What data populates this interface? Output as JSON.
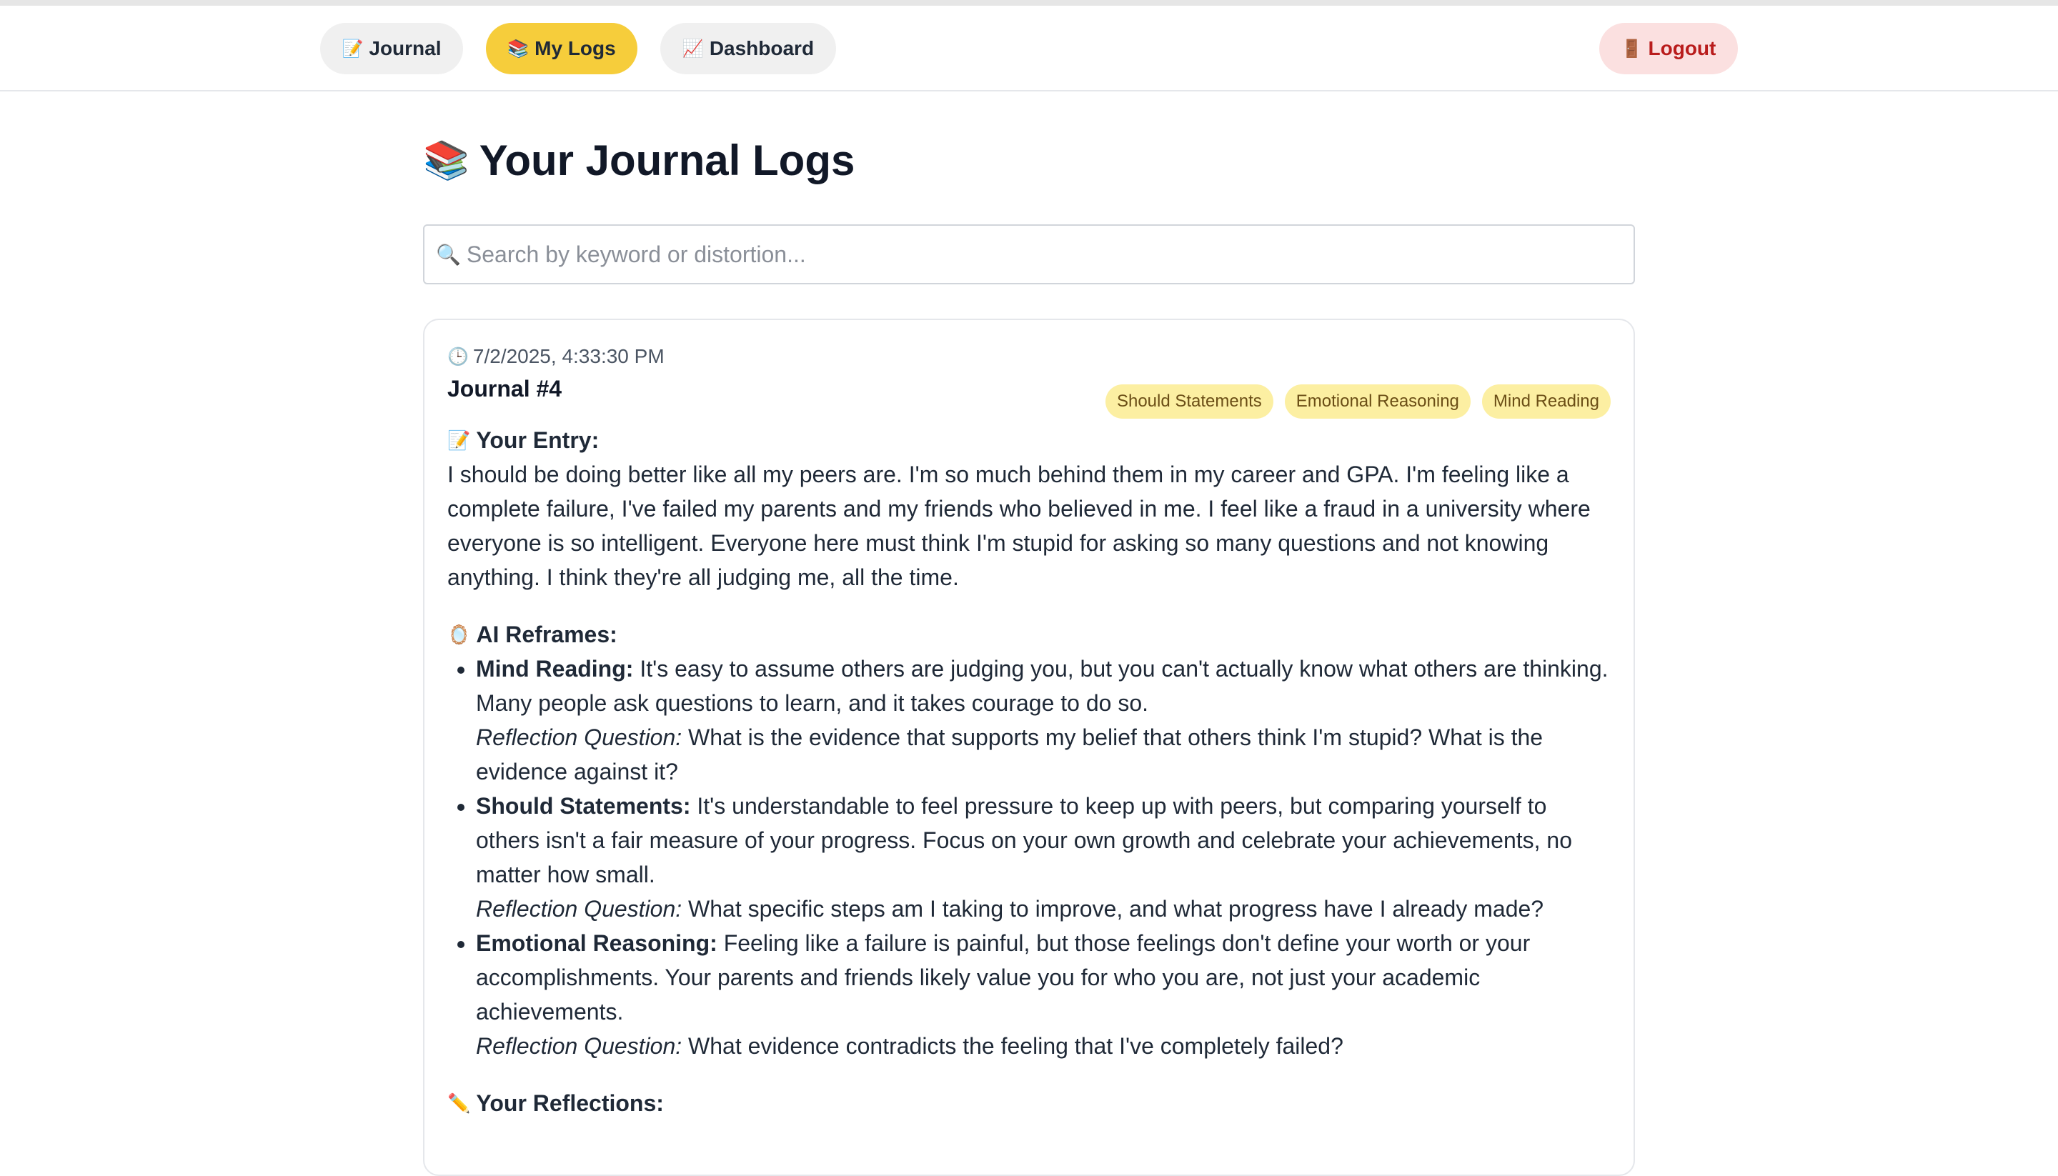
{
  "nav": {
    "journal": {
      "icon": "📝",
      "label": "Journal"
    },
    "my_logs": {
      "icon": "📚",
      "label": "My Logs"
    },
    "dashboard": {
      "icon": "📈",
      "label": "Dashboard"
    },
    "logout": {
      "icon": "🚪",
      "label": "Logout"
    }
  },
  "page": {
    "title_icon": "📚",
    "title": "Your Journal Logs"
  },
  "search": {
    "icon": "🔍",
    "placeholder": "Search by keyword or distortion...",
    "value": ""
  },
  "entries": [
    {
      "timestamp_icon": "🕒",
      "timestamp": "7/2/2025, 4:33:30 PM",
      "title": "Journal #4",
      "tags": [
        "Should Statements",
        "Emotional Reasoning",
        "Mind Reading"
      ],
      "entry_label_icon": "📝",
      "entry_label": "Your Entry:",
      "entry_text": "I should be doing better like all my peers are. I'm so much behind them in my career and GPA. I'm feeling like a complete failure, I've failed my parents and my friends who believed in me. I feel like a fraud in a university where everyone is so intelligent. Everyone here must think I'm stupid for asking so many questions and not knowing anything. I think they're all judging me, all the time.",
      "ai_label_icon": "🪞",
      "ai_label": "AI Reframes:",
      "reframes": [
        {
          "distortion": "Mind Reading:",
          "text": "It's easy to assume others are judging you, but you can't actually know what others are thinking. Many people ask questions to learn, and it takes courage to do so.",
          "question_label": "Reflection Question:",
          "question": "What is the evidence that supports my belief that others think I'm stupid? What is the evidence against it?"
        },
        {
          "distortion": "Should Statements:",
          "text": "It's understandable to feel pressure to keep up with peers, but comparing yourself to others isn't a fair measure of your progress. Focus on your own growth and celebrate your achievements, no matter how small.",
          "question_label": "Reflection Question:",
          "question": "What specific steps am I taking to improve, and what progress have I already made?"
        },
        {
          "distortion": "Emotional Reasoning:",
          "text": "Feeling like a failure is painful, but those feelings don't define your worth or your accomplishments. Your parents and friends likely value you for who you are, not just your academic achievements.",
          "question_label": "Reflection Question:",
          "question": "What evidence contradicts the feeling that I've completely failed?"
        }
      ],
      "reflections_label_icon": "✏️",
      "reflections_label": "Your Reflections:"
    }
  ]
}
